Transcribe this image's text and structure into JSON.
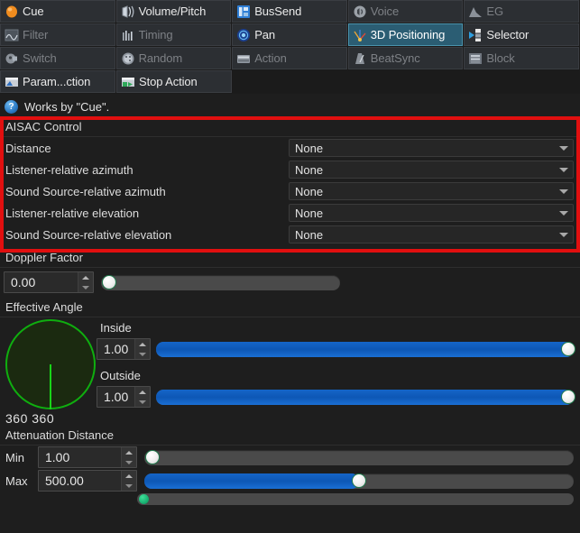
{
  "tabs": {
    "rows": [
      [
        {
          "label": "Cue",
          "icon": "cue-sphere-icon",
          "state": "enabled"
        },
        {
          "label": "Volume/Pitch",
          "icon": "volume-pitch-icon",
          "state": "enabled"
        },
        {
          "label": "BusSend",
          "icon": "bus-send-icon",
          "state": "enabled"
        },
        {
          "label": "Voice",
          "icon": "voice-icon",
          "state": "disabled"
        },
        {
          "label": "EG",
          "icon": "envelope-generator-icon",
          "state": "disabled"
        }
      ],
      [
        {
          "label": "Filter",
          "icon": "filter-curve-icon",
          "state": "disabled"
        },
        {
          "label": "Timing",
          "icon": "timing-icon",
          "state": "disabled"
        },
        {
          "label": "Pan",
          "icon": "pan-icon",
          "state": "enabled"
        },
        {
          "label": "3D Positioning",
          "icon": "3d-positioning-icon",
          "state": "active"
        },
        {
          "label": "Selector",
          "icon": "selector-icon",
          "state": "enabled"
        }
      ],
      [
        {
          "label": "Switch",
          "icon": "switch-icon",
          "state": "disabled"
        },
        {
          "label": "Random",
          "icon": "random-dice-icon",
          "state": "disabled"
        },
        {
          "label": "Action",
          "icon": "action-icon",
          "state": "disabled"
        },
        {
          "label": "BeatSync",
          "icon": "beatsync-metronome-icon",
          "state": "disabled"
        },
        {
          "label": "Block",
          "icon": "block-icon",
          "state": "disabled"
        }
      ],
      [
        {
          "label": "Param...ction",
          "icon": "param-action-icon",
          "state": "enabled"
        },
        {
          "label": "Stop Action",
          "icon": "stop-action-icon",
          "state": "enabled"
        }
      ]
    ]
  },
  "help": {
    "icon": "question-mark-icon",
    "glyph": "?",
    "text": "Works by \"Cue\"."
  },
  "aisac": {
    "title": "AISAC Control",
    "rows": [
      {
        "label": "Distance",
        "value": "None"
      },
      {
        "label": "Listener-relative azimuth",
        "value": "None"
      },
      {
        "label": "Sound Source-relative azimuth",
        "value": "None"
      },
      {
        "label": "Listener-relative elevation",
        "value": "None"
      },
      {
        "label": "Sound Source-relative elevation",
        "value": "None"
      }
    ]
  },
  "doppler": {
    "title": "Doppler Factor",
    "value": "0.00",
    "slider_percent": 0
  },
  "effective_angle": {
    "title": "Effective Angle",
    "dial_values": "360 360",
    "inside": {
      "label": "Inside",
      "value": "1.00",
      "slider_percent": 100
    },
    "outside": {
      "label": "Outside",
      "value": "1.00",
      "slider_percent": 100
    }
  },
  "attenuation": {
    "title": "Attenuation Distance",
    "min": {
      "label": "Min",
      "value": "1.00",
      "slider_percent": 0
    },
    "max": {
      "label": "Max",
      "value": "500.00",
      "slider_percent": 50
    }
  },
  "colors": {
    "highlight_box": "#e10f0f",
    "accent_blue": "#1565c8",
    "active_tab": "#2b5d73",
    "dial_green": "#0fae0f"
  }
}
